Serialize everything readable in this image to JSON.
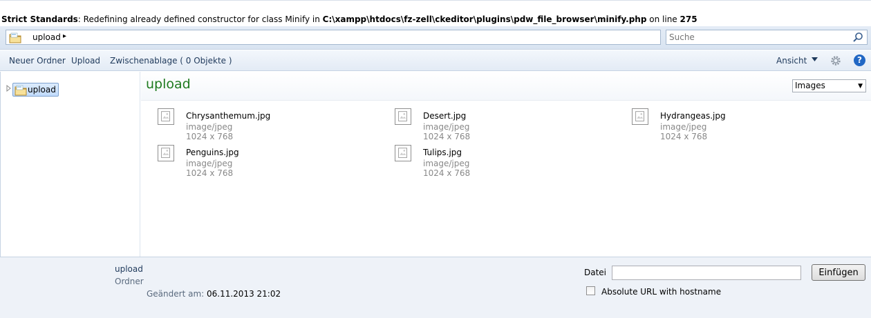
{
  "warning": {
    "label": "Strict Standards",
    "message": ": Redefining already defined constructor for class Minify in ",
    "path": "C:\\xampp\\htdocs\\fz-zell\\ckeditor\\plugins\\pdw_file_browser\\minify.php",
    "on_line": " on line ",
    "line": "275"
  },
  "address": {
    "path": "upload",
    "arrow": "▸"
  },
  "search": {
    "placeholder": "Suche"
  },
  "toolbar": {
    "new_folder": "Neuer Ordner",
    "upload": "Upload",
    "clipboard": "Zwischenablage ( 0 Objekte )",
    "view": "Ansicht",
    "help": "?"
  },
  "tree": {
    "root": "upload"
  },
  "main": {
    "title": "upload",
    "filter": "Images",
    "files": [
      {
        "name": "Chrysanthemum.jpg",
        "type": "image/jpeg",
        "dims": "1024 x 768"
      },
      {
        "name": "Desert.jpg",
        "type": "image/jpeg",
        "dims": "1024 x 768"
      },
      {
        "name": "Hydrangeas.jpg",
        "type": "image/jpeg",
        "dims": "1024 x 768"
      },
      {
        "name": "Penguins.jpg",
        "type": "image/jpeg",
        "dims": "1024 x 768"
      },
      {
        "name": "Tulips.jpg",
        "type": "image/jpeg",
        "dims": "1024 x 768"
      }
    ]
  },
  "footer": {
    "name": "upload",
    "type": "Ordner",
    "modified_label": "Geändert am: ",
    "modified_value": "06.11.2013 21:02",
    "file_label": "Datei",
    "file_value": "",
    "insert": "Einfügen",
    "absolute_url": "Absolute URL with hostname"
  },
  "colors": {
    "accent": "#1e395b",
    "title_green": "#1e7a1e",
    "help_blue": "#2167c4"
  }
}
